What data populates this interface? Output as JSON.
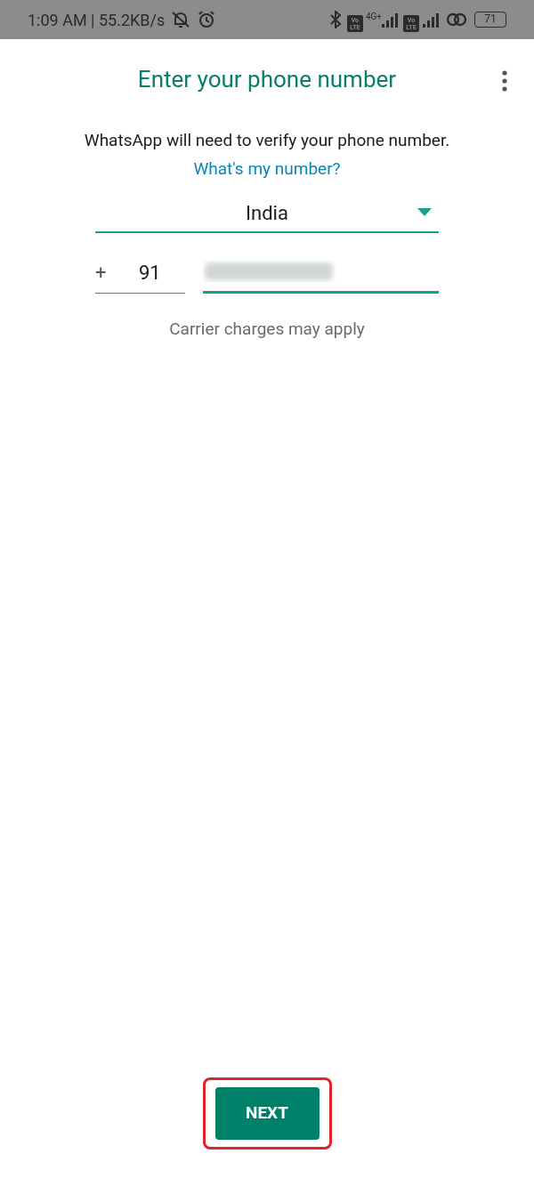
{
  "status_bar": {
    "time": "1:09 AM | 55.2KB/s",
    "network": "4G+",
    "volte": [
      "Vo LTE",
      "Vo LTE"
    ],
    "battery": "71"
  },
  "header": {
    "title": "Enter your phone number"
  },
  "description": {
    "text": "WhatsApp will need to verify your phone number.",
    "link": "What's my number?"
  },
  "country": {
    "value": "India"
  },
  "phone": {
    "prefix": "+",
    "country_code": "91",
    "number_redacted": true
  },
  "note": "Carrier charges may apply",
  "next_button": {
    "label": "NEXT",
    "highlighted": true
  }
}
